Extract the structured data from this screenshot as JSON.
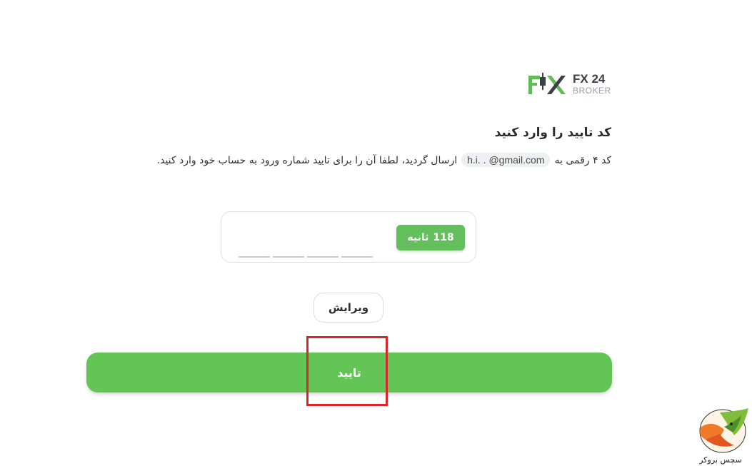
{
  "logo": {
    "title": "FX 24",
    "subtitle": "BROKER",
    "mark_color": "#62b957",
    "mark_dark_color": "#3b3f46"
  },
  "verification": {
    "heading": "کد تایید را وارد کنید",
    "desc_before": "کد ۴ رقمی به",
    "email": "h.i.       .     @gmail.com",
    "desc_after": "ارسال گردید، لطفا آن را برای تایید شماره ورود به حساب خود وارد کنید."
  },
  "otp": {
    "digits": [
      "",
      "",
      "",
      ""
    ],
    "timer_seconds": "118",
    "timer_unit": "ثانیه"
  },
  "buttons": {
    "edit_label": "ویرایش",
    "confirm_label": "تایید"
  },
  "colors": {
    "accent_green": "#63c555",
    "highlight_red": "#d9262c"
  },
  "watermark": {
    "text": "سچس بروکر"
  }
}
